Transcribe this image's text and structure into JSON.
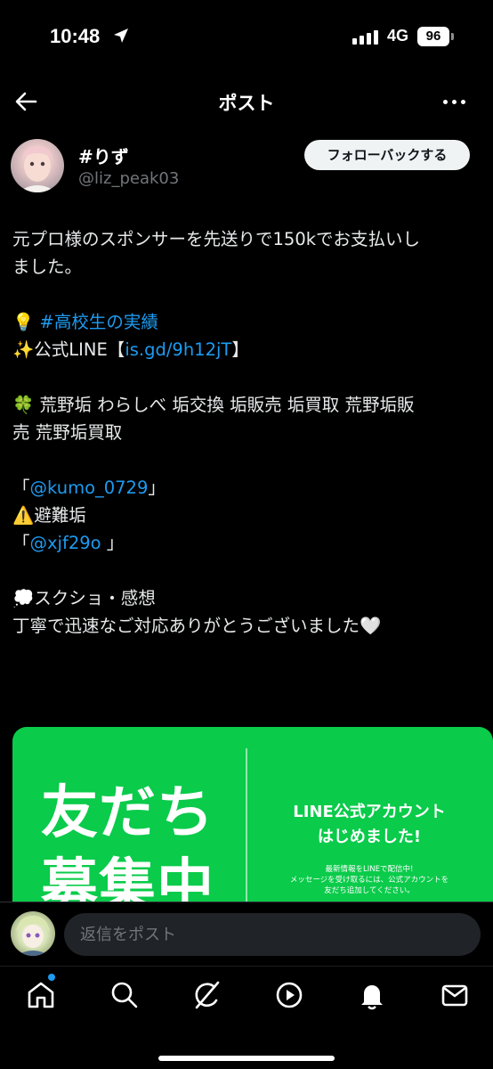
{
  "status_bar": {
    "time": "10:48",
    "network": "4G",
    "battery": "96"
  },
  "header": {
    "title": "ポスト",
    "back_icon": "arrow-left-icon",
    "more_icon": "more-horizontal-icon"
  },
  "author": {
    "display_name": "#りず",
    "handle": "@liz_peak03",
    "follow_label": "フォローバックする"
  },
  "post": {
    "lines": [
      "元プロ様のスポンサーを先送りで150kでお支払いし",
      "ました。",
      "",
      "💡 ",
      "✨公式LINE【",
      "",
      "🍀 荒野垢 わらしべ 垢交換 垢販売 垢買取 荒野垢販",
      "売 荒野垢買取",
      "",
      "「",
      "⚠️避難垢",
      "「",
      "",
      "💭スクショ・感想",
      "丁寧で迅速なご対応ありがとうございました🤍"
    ],
    "hashtag": "#高校生の実績",
    "line_link": "is.gd/9h12jT",
    "line_link_close": "】",
    "mention1": "@kumo_0729",
    "mention1_close": "」",
    "mention2": "@xjf29o",
    "mention2_close": " 」"
  },
  "media": {
    "big_text_line1": "友だち",
    "big_text_line2": "募集中",
    "title_line1": "LINE公式アカウント",
    "title_line2": "はじめました!",
    "small_line1": "最新情報をLINEで配信中!",
    "small_line2": "メッセージを受け取るには、公式アカウントを",
    "small_line3": "友だち追加してください。",
    "bg_color": "#0acb4a"
  },
  "reply": {
    "placeholder": "返信をポスト"
  },
  "tabs": [
    {
      "name": "home-icon",
      "has_badge": true
    },
    {
      "name": "search-icon"
    },
    {
      "name": "grok-icon"
    },
    {
      "name": "video-icon"
    },
    {
      "name": "notifications-bell-icon"
    },
    {
      "name": "messages-mail-icon"
    }
  ],
  "colors": {
    "link": "#1d9bf0",
    "background": "#000000",
    "text": "#e7e9ea",
    "muted": "#71767b"
  }
}
